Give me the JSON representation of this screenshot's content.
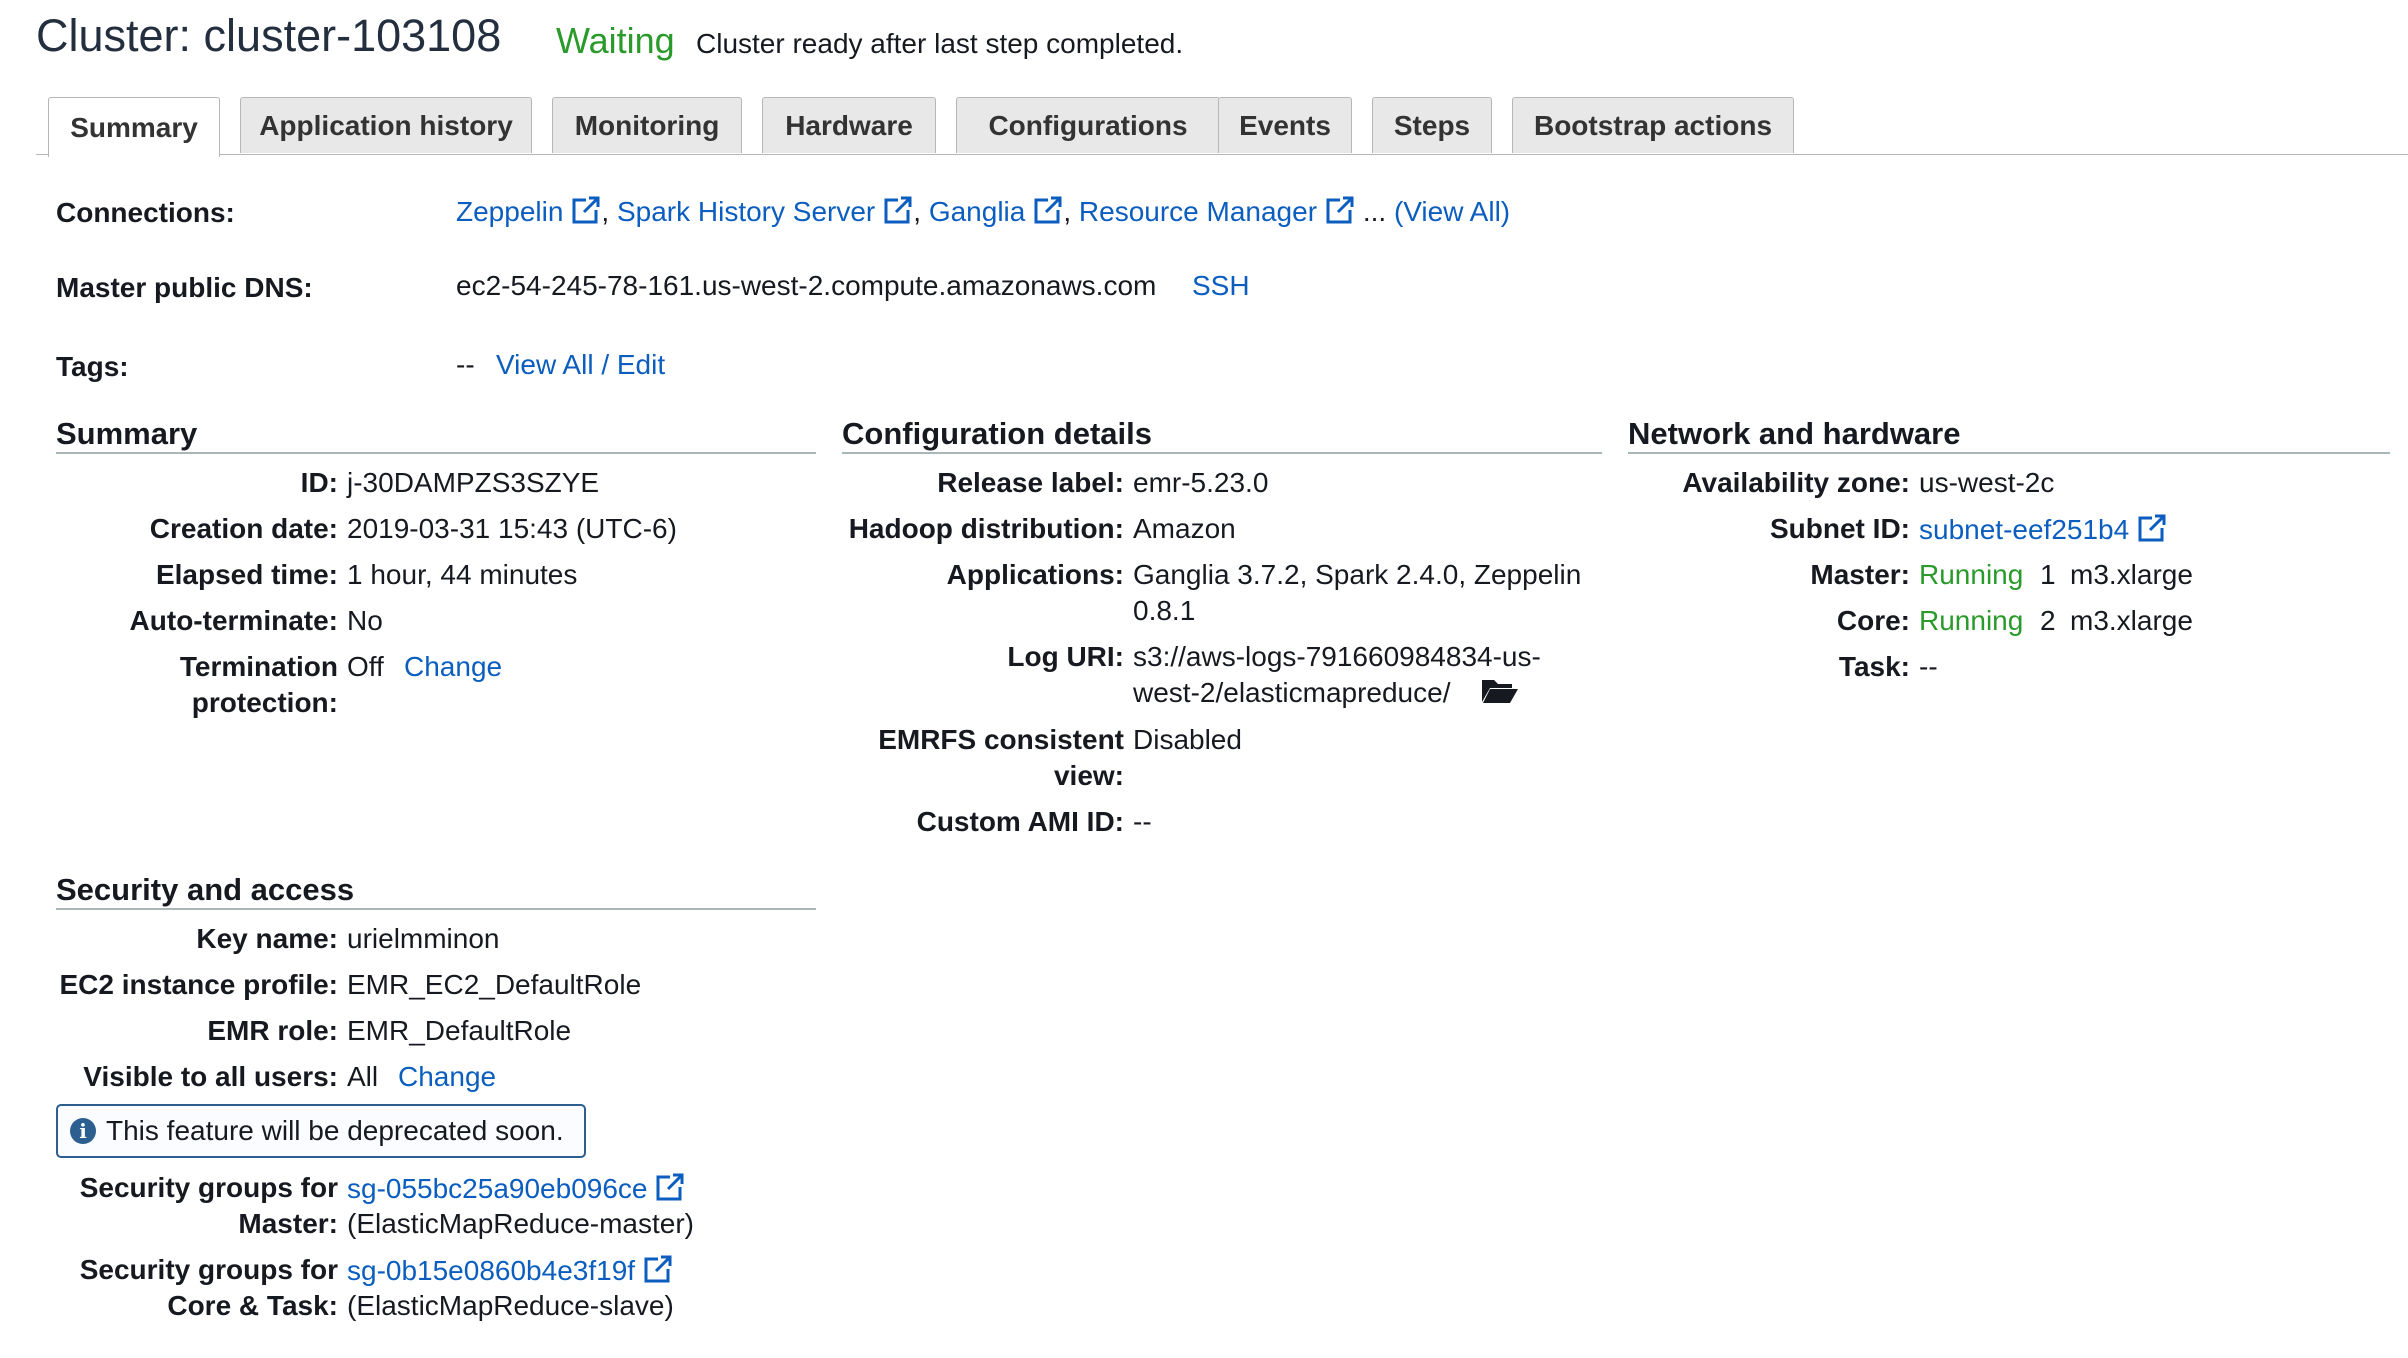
{
  "header": {
    "title": "Cluster: cluster-103108",
    "status": "Waiting",
    "status_message": "Cluster ready after last step completed."
  },
  "tabs": [
    "Summary",
    "Application history",
    "Monitoring",
    "Hardware",
    "Configurations",
    "Events",
    "Steps",
    "Bootstrap actions"
  ],
  "active_tab": "Summary",
  "top": {
    "connections_label": "Connections:",
    "connections": [
      "Zeppelin",
      "Spark History Server",
      "Ganglia",
      "Resource Manager"
    ],
    "ellipsis": "...",
    "view_all": "(View All)",
    "dns_label": "Master public DNS:",
    "dns_value": "ec2-54-245-78-161.us-west-2.compute.amazonaws.com",
    "ssh": "SSH",
    "tags_label": "Tags:",
    "tags_value": "--",
    "tags_link": "View All / Edit"
  },
  "summary": {
    "heading": "Summary",
    "id_label": "ID:",
    "id": "j-30DAMPZS3SZYE",
    "creation_label": "Creation date:",
    "creation": "2019-03-31 15:43 (UTC-6)",
    "elapsed_label": "Elapsed time:",
    "elapsed": "1 hour, 44 minutes",
    "autoterm_label": "Auto-terminate:",
    "autoterm": "No",
    "termprot_label_1": "Termination",
    "termprot_label_2": "protection:",
    "termprot": "Off",
    "change": "Change"
  },
  "config": {
    "heading": "Configuration details",
    "release_label": "Release label:",
    "release": "emr-5.23.0",
    "hadoop_label": "Hadoop distribution:",
    "hadoop": "Amazon",
    "apps_label": "Applications:",
    "apps_1": "Ganglia 3.7.2, Spark 2.4.0, Zeppelin",
    "apps_2": "0.8.1",
    "log_label": "Log URI:",
    "log_1": "s3://aws-logs-791660984834-us-",
    "log_2": "west-2/elasticmapreduce/",
    "emrfs_label_1": "EMRFS consistent",
    "emrfs_label_2": "view:",
    "emrfs": "Disabled",
    "ami_label": "Custom AMI ID:",
    "ami": "--"
  },
  "network": {
    "heading": "Network and hardware",
    "az_label": "Availability zone:",
    "az": "us-west-2c",
    "subnet_label": "Subnet ID:",
    "subnet": "subnet-eef251b4",
    "master_label": "Master:",
    "master_state": "Running",
    "master_count": "1",
    "master_type": "m3.xlarge",
    "core_label": "Core:",
    "core_state": "Running",
    "core_count": "2",
    "core_type": "m3.xlarge",
    "task_label": "Task:",
    "task": "--"
  },
  "security": {
    "heading": "Security and access",
    "key_label": "Key name:",
    "key": "urielmminon",
    "profile_label": "EC2 instance profile:",
    "profile": "EMR_EC2_DefaultRole",
    "role_label": "EMR role:",
    "role": "EMR_DefaultRole",
    "visible_label": "Visible to all users:",
    "visible": "All",
    "change": "Change",
    "notice": "This feature will be deprecated soon.",
    "sg_master_label_1": "Security groups for",
    "sg_master_label_2": "Master:",
    "sg_master": "sg-055bc25a90eb096ce",
    "sg_master_name": "(ElasticMapReduce-master)",
    "sg_core_label_1": "Security groups for",
    "sg_core_label_2": "Core & Task:",
    "sg_core": "sg-0b15e0860b4e3f19f",
    "sg_core_name": "(ElasticMapReduce-slave)"
  },
  "colors": {
    "link": "#0b5ebf",
    "running": "#2a9a2a",
    "notice_border": "#2c5e8f"
  },
  "icons": {
    "external": "external-link-icon",
    "folder": "folder-open-icon",
    "info": "info-icon"
  }
}
